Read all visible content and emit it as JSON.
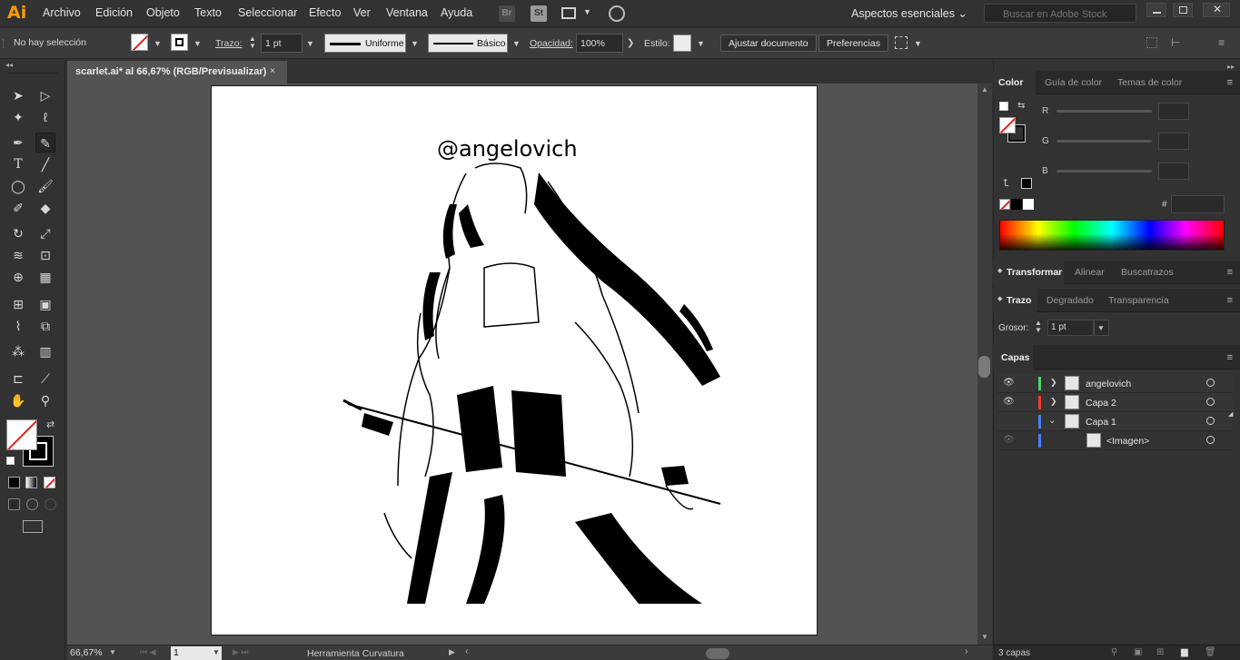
{
  "app": {
    "logo": "Ai"
  },
  "menu": [
    "Archivo",
    "Edición",
    "Objeto",
    "Texto",
    "Seleccionar",
    "Efecto",
    "Ver",
    "Ventana",
    "Ayuda"
  ],
  "menubar_icons": {
    "bridge": "Br",
    "stock": "St"
  },
  "workspace": {
    "label": "Aspectos esenciales ⌄"
  },
  "stock_search": {
    "placeholder": "Buscar en Adobe Stock"
  },
  "control": {
    "selection_status": "No hay selección",
    "stroke_label": "Trazo:",
    "stroke_weight": "1 pt",
    "variable_width": "Uniforme",
    "brush": "Básico",
    "opacity_label": "Opacidad:",
    "opacity": "100%",
    "style_label": "Estilo:",
    "document_setup_button": "Ajustar documento",
    "preferences_button": "Preferencias"
  },
  "document": {
    "tab_title": "scarlet.ai* al 66,67% (RGB/Previsualizar)",
    "close_glyph": "×",
    "artboard_text": "@angelovich"
  },
  "status": {
    "zoom": "66,67%",
    "artboard_number": "1",
    "current_tool": "Herramienta Curvatura"
  },
  "panels": {
    "color_tabs": [
      "Color",
      "Guía de color",
      "Temas de color"
    ],
    "rgb_labels": [
      "R",
      "G",
      "B"
    ],
    "hex_label": "#",
    "transform_tabs": [
      "Transformar",
      "Alinear",
      "Buscatrazos"
    ],
    "stroke_tabs": [
      "Trazo",
      "Degradado",
      "Transparencia"
    ],
    "weight_label": "Grosor:",
    "weight_value": "1 pt",
    "layers_title": "Capas",
    "layers": [
      {
        "name": "angelovich",
        "color": "#4cd964",
        "visible": true
      },
      {
        "name": "Capa 2",
        "color": "#ff3b30",
        "visible": true
      },
      {
        "name": "Capa 1",
        "color": "#4a7dff",
        "visible": false
      },
      {
        "name": "<Imagen>",
        "color": "#4a7dff",
        "visible": false
      }
    ],
    "layers_count": "3 capas"
  },
  "colors": {
    "accent_logo": "#ff9a00",
    "ui_dark": "#323232",
    "canvas_bg": "#535353"
  }
}
